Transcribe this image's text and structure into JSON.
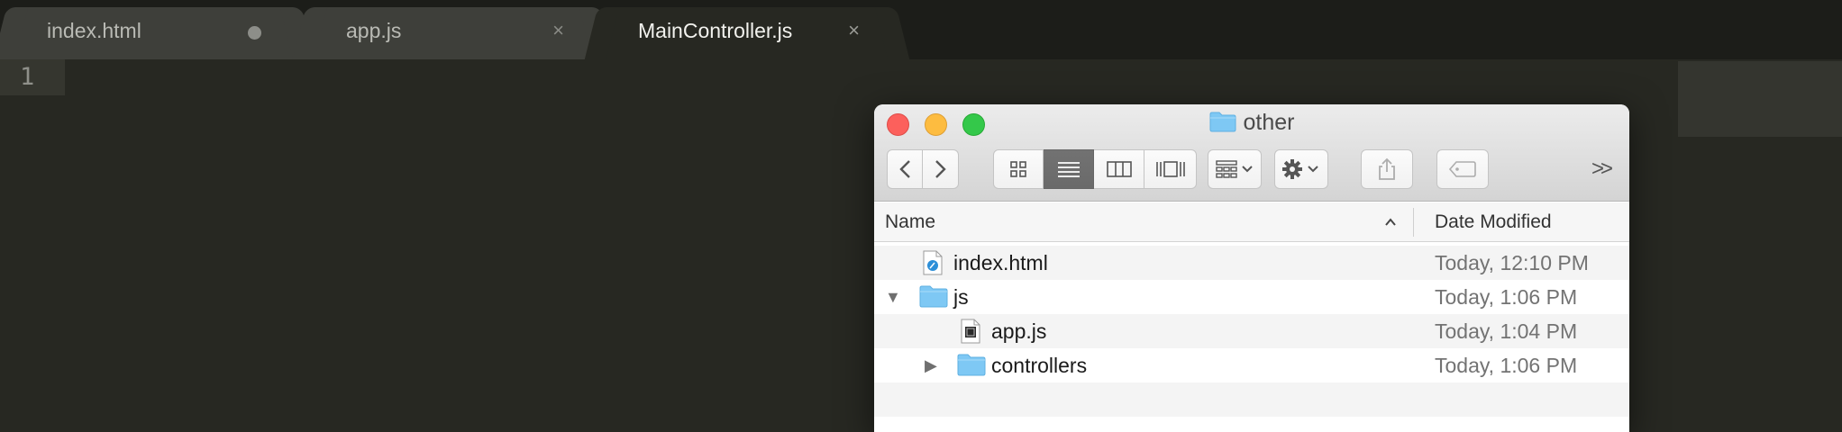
{
  "editor": {
    "tabs": [
      {
        "label": "index.html",
        "state": "modified"
      },
      {
        "label": "app.js",
        "close": "×"
      },
      {
        "label": "MainController.js",
        "close": "×",
        "active": true
      }
    ],
    "line_number": "1"
  },
  "finder": {
    "title": "other",
    "columns": {
      "name": "Name",
      "date": "Date Modified"
    },
    "rows": [
      {
        "name": "index.html",
        "date": "Today, 12:10 PM",
        "icon": "html-file-icon"
      },
      {
        "name": "js",
        "date": "Today, 1:06 PM",
        "icon": "folder-icon",
        "expanded": true
      },
      {
        "name": "app.js",
        "date": "Today, 1:04 PM",
        "icon": "js-file-icon"
      },
      {
        "name": "controllers",
        "date": "Today, 1:06 PM",
        "icon": "folder-icon",
        "expanded": false
      }
    ],
    "colors": {
      "folder": "#7ec8f4",
      "close": "#fc605c",
      "minimize": "#fdbc40",
      "zoom": "#34c84a"
    }
  }
}
